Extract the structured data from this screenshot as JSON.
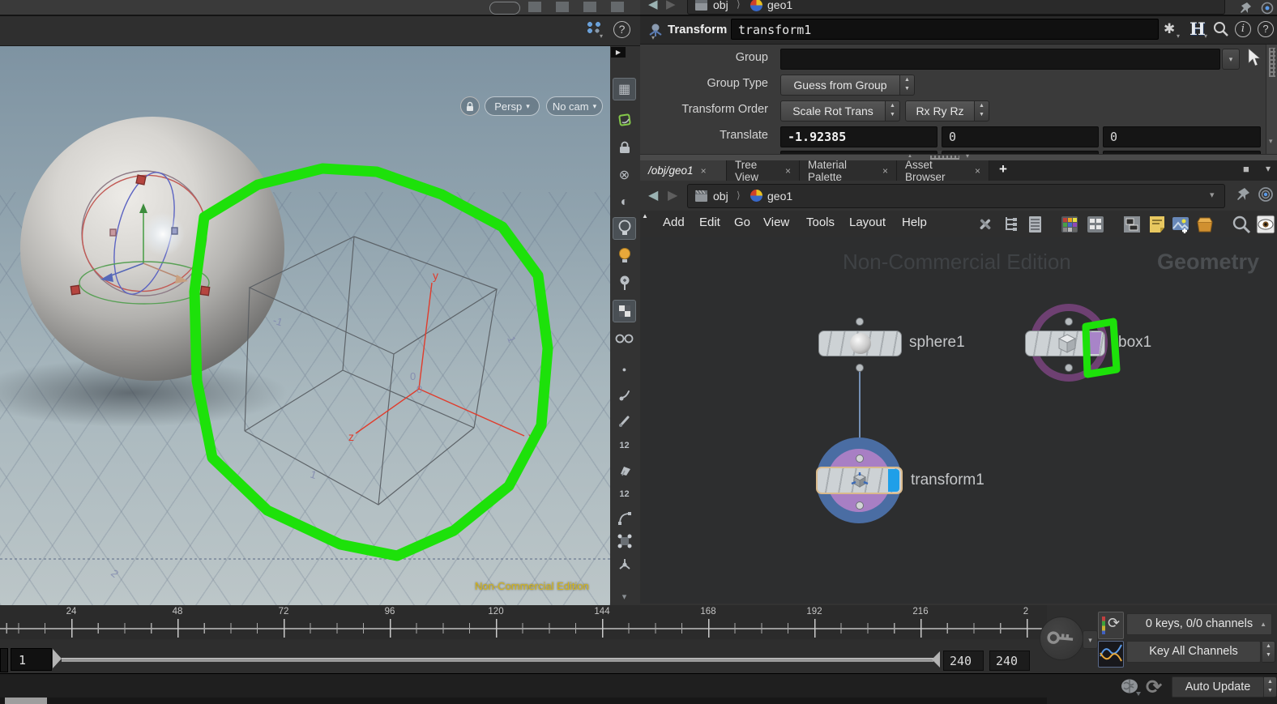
{
  "viewport": {
    "persp": "Persp",
    "no_cam": "No cam",
    "watermark": "Non-Commercial Edition",
    "axis": {
      "x": "x",
      "y": "y",
      "z": "z"
    },
    "grid_labels": [
      "-1",
      "1",
      "0",
      "0",
      "1",
      "2"
    ]
  },
  "viewport_toolbar": {
    "icons": [
      "stow-arrow",
      "grid-plane",
      "snapping",
      "view-lock",
      "no-lights",
      "headlight-only",
      "normal-lights",
      "high-quality-lights",
      "light-pin",
      "smooth-shaded",
      "visualizers",
      "points",
      "point-normals",
      "point-markers",
      "point-numbers",
      "primitives",
      "primitive-numbers",
      "profiles",
      "handles",
      "pivot",
      "scroll-down"
    ]
  },
  "params": {
    "type_label": "Transform",
    "name_value": "transform1",
    "group_label": "Group",
    "group_value": "",
    "group_type_label": "Group Type",
    "group_type_value": "Guess from Group",
    "transform_order_label": "Transform Order",
    "transform_order_value": "Scale Rot Trans",
    "rotate_order_value": "Rx Ry Rz",
    "translate_label": "Translate",
    "translate_x": "-1.92385",
    "translate_y": "0",
    "translate_z": "0"
  },
  "top_path": {
    "obj": "obj",
    "geo": "geo1"
  },
  "network": {
    "tabs": [
      {
        "label": "/obj/geo1"
      },
      {
        "label": "Tree View"
      },
      {
        "label": "Material Palette"
      },
      {
        "label": "Asset Browser"
      }
    ],
    "path": {
      "obj": "obj",
      "geo": "geo1"
    },
    "menus": [
      "Add",
      "Edit",
      "Go",
      "View",
      "Tools",
      "Layout",
      "Help"
    ],
    "watermark": "Non-Commercial Edition",
    "badge": "Geometry",
    "nodes": {
      "sphere": "sphere1",
      "box": "box1",
      "transform": "transform1"
    }
  },
  "timeline": {
    "ticks": [
      "24",
      "48",
      "72",
      "96",
      "120",
      "144",
      "168",
      "192",
      "216",
      "2"
    ],
    "frame": "1",
    "range_end": "240",
    "range_end2": "240",
    "keys": "0 keys, 0/0 channels",
    "key_mode": "Key All Channels"
  },
  "footer": {
    "auto_update": "Auto Update"
  },
  "glyphs": {
    "close": "×",
    "plus": "+",
    "caret": "▾",
    "up": "▲",
    "down": "▼",
    "back": "◀",
    "fwd": "▶",
    "square": "■",
    "question": "?",
    "info": "i",
    "gear": "✱",
    "h_logo": "H",
    "chev": "⟩",
    "recycle": "⟳",
    "dot": "●",
    "nolight": "⊗",
    "headlight": "◐",
    "grid": "▦"
  },
  "colors": {
    "annotation_green": "#1de10a",
    "select_outline": "#d9ba8c",
    "display_flag_blue": "#1f9fe8",
    "template_purple": "#a884c8",
    "node_ring_purple": "#6e4072",
    "selected_ring_blue": "#4a6da3",
    "selected_ring_violet": "#a87fc4",
    "watermark_yellow": "#d6b61a"
  }
}
